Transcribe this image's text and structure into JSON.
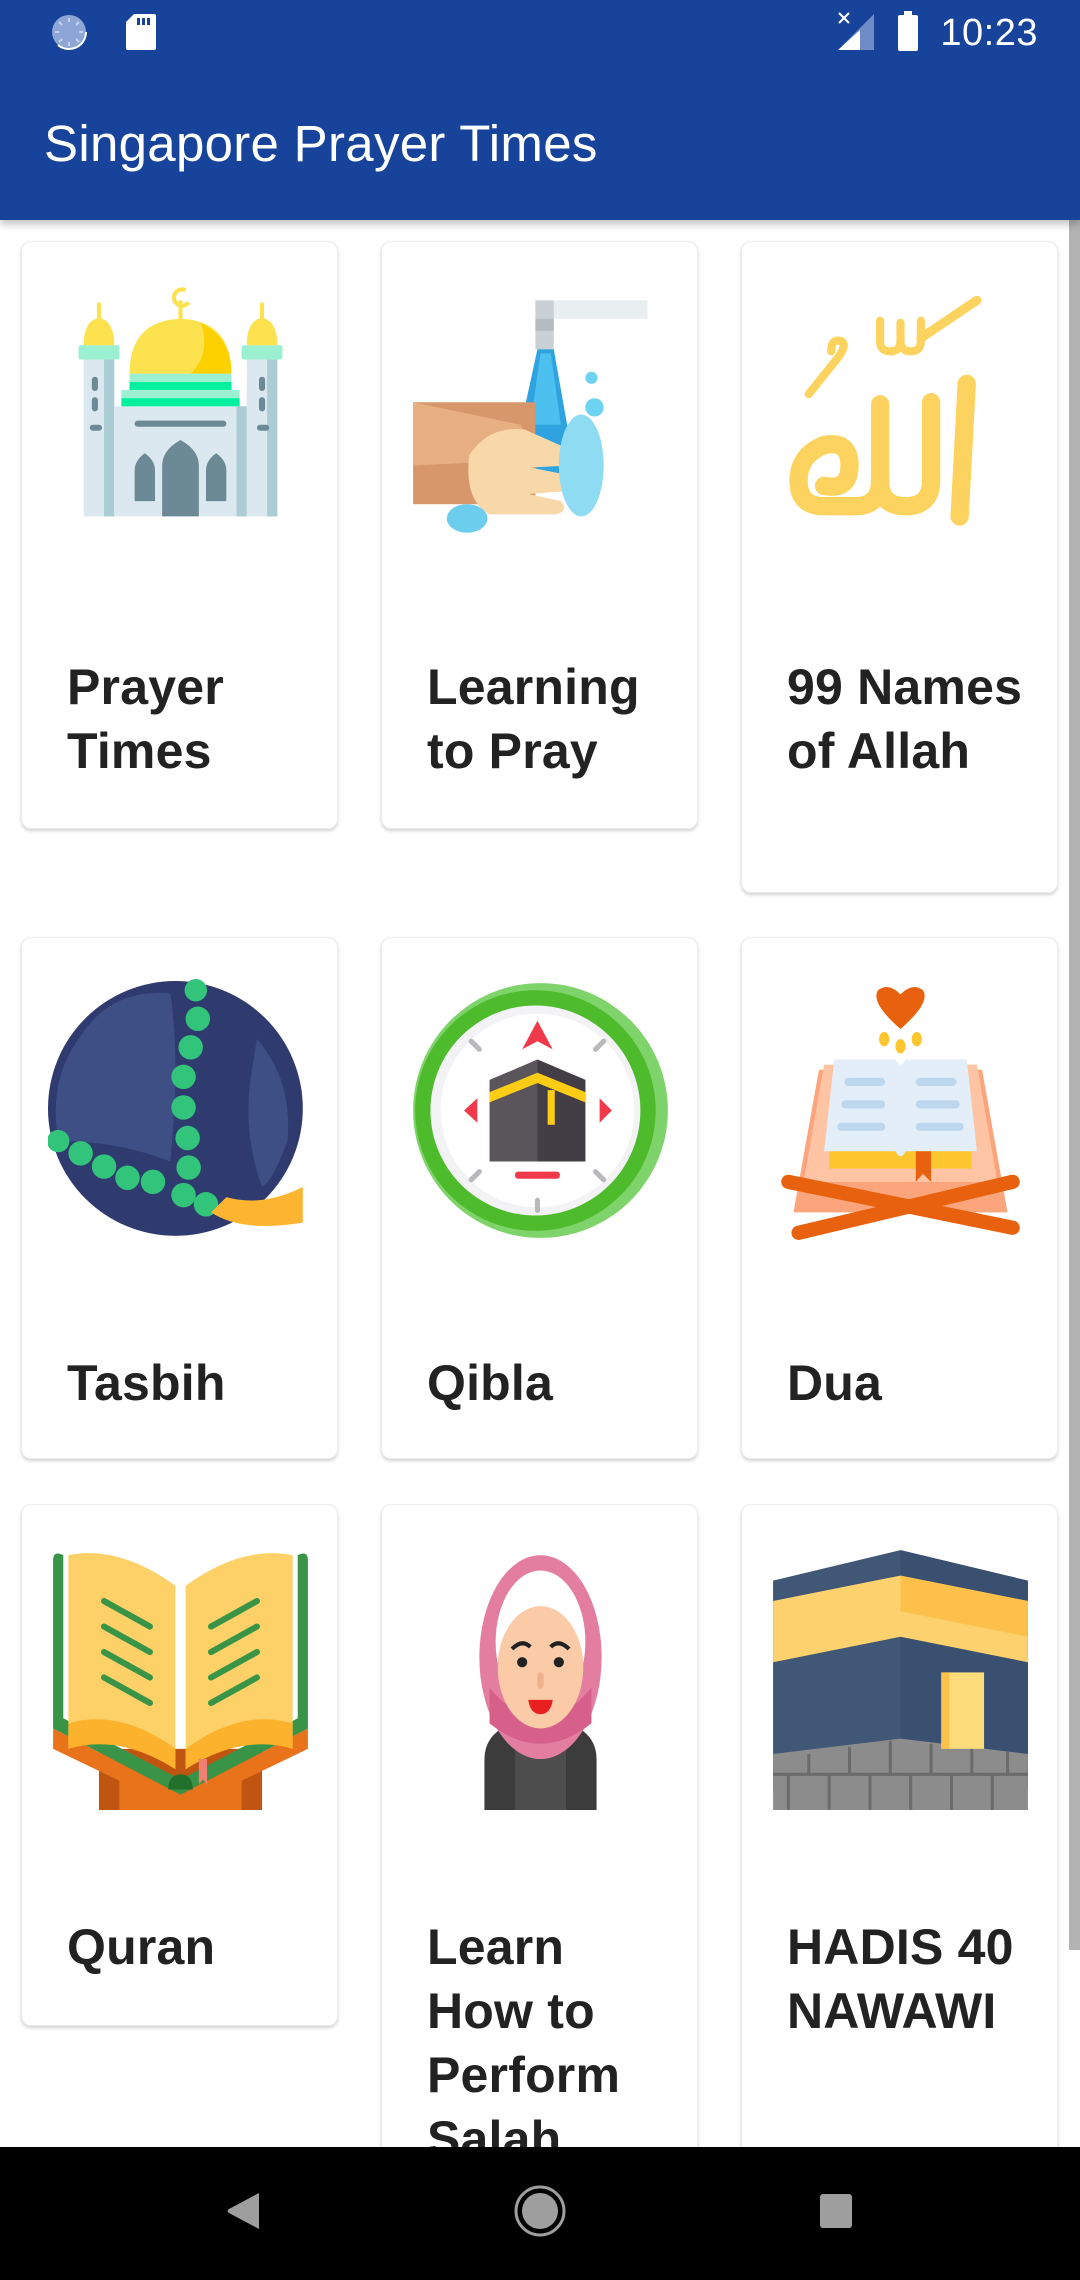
{
  "status_bar": {
    "time": "10:23",
    "left_icons": [
      "sync-icon",
      "sd-card-icon"
    ],
    "right_icons": [
      "signal-no-connection-icon",
      "battery-full-icon"
    ]
  },
  "toolbar": {
    "title": "Singapore Prayer Times"
  },
  "colors": {
    "primary": "#17449a",
    "card_text": "#222222",
    "nav_bar": "#000000"
  },
  "grid": {
    "items": [
      {
        "label": "Prayer Times",
        "icon": "mosque-icon"
      },
      {
        "label": "Learning to Pray",
        "icon": "hand-washing-icon"
      },
      {
        "label": "99 Names of Allah",
        "icon": "allah-calligraphy-icon"
      },
      {
        "label": "Tasbih",
        "icon": "prayer-beads-icon"
      },
      {
        "label": "Qibla",
        "icon": "qibla-compass-icon"
      },
      {
        "label": "Dua",
        "icon": "open-book-heart-icon"
      },
      {
        "label": "Quran",
        "icon": "quran-stand-icon"
      },
      {
        "label": "Learn How to Perform Salah",
        "icon": "hijab-woman-icon"
      },
      {
        "label": "HADIS 40 NAWAWI",
        "icon": "kaaba-icon"
      }
    ]
  },
  "nav_bar": {
    "buttons": [
      "back",
      "home",
      "recents"
    ]
  }
}
